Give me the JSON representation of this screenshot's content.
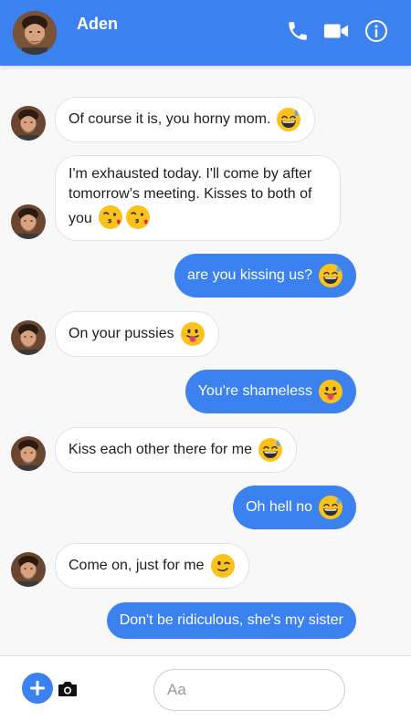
{
  "header": {
    "contact_name": "Aden",
    "icons": [
      "phone-icon",
      "video-camera-icon",
      "info-icon"
    ],
    "color": "#3b82f0"
  },
  "messages": [
    {
      "from": "contact",
      "text": "Of course it is, you horny mom.",
      "emojis": [
        "grinning-sweat"
      ]
    },
    {
      "from": "contact",
      "text": "I'm exhausted today. I'll come by after tomorrow’s meeting. Kisses to both of you",
      "emojis": [
        "kissing-heart",
        "kissing-heart"
      ]
    },
    {
      "from": "me",
      "text": "are you kissing us?",
      "emojis": [
        "grinning-sweat"
      ]
    },
    {
      "from": "contact",
      "text": "On your pussies",
      "emojis": [
        "tongue-out"
      ]
    },
    {
      "from": "me",
      "text": "You're shameless",
      "emojis": [
        "tongue-out"
      ]
    },
    {
      "from": "contact",
      "text": "Kiss each other there for me",
      "emojis": [
        "grinning-sweat"
      ]
    },
    {
      "from": "me",
      "text": "Oh hell no",
      "emojis": [
        "grinning-sweat"
      ]
    },
    {
      "from": "contact",
      "text": "Come on, just for me",
      "emojis": [
        "winking"
      ]
    },
    {
      "from": "me",
      "text": "Don't be ridiculous, she's my sister",
      "emojis": []
    }
  ],
  "composer": {
    "placeholder": "Aa",
    "value": ""
  },
  "colors": {
    "accent": "#3b82f0",
    "incoming_bubble": "#ffffff",
    "background": "#f8f8f8"
  }
}
